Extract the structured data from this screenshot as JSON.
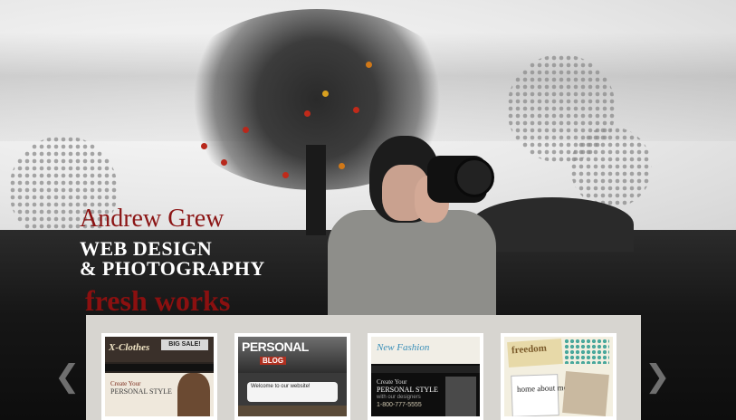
{
  "hero": {
    "name": "Andrew Grew",
    "subtitle_line1": "WEB DESIGN",
    "subtitle_line2": "& PHOTOGRAPHY",
    "section_title": "fresh works"
  },
  "gallery": {
    "prev_arrow": "❮",
    "next_arrow": "❯",
    "thumbs": [
      {
        "logo": "X-Clothes",
        "banner": "BIG SALE!",
        "line1": "Create Your",
        "line2": "PERSONAL STYLE"
      },
      {
        "title": "PERSONAL",
        "tag": "BLOG",
        "welcome": "Welcome to our website!"
      },
      {
        "logo": "New Fashion",
        "line1": "Create Your",
        "line2": "PERSONAL STYLE",
        "line3": "with our designers",
        "phone": "1-800-777-5555"
      },
      {
        "logo": "freedom",
        "note": "home about me"
      }
    ]
  },
  "colors": {
    "name_red": "#8b1414",
    "fresh_red": "#8b1010",
    "panel_bg": "#d7d5d0"
  }
}
